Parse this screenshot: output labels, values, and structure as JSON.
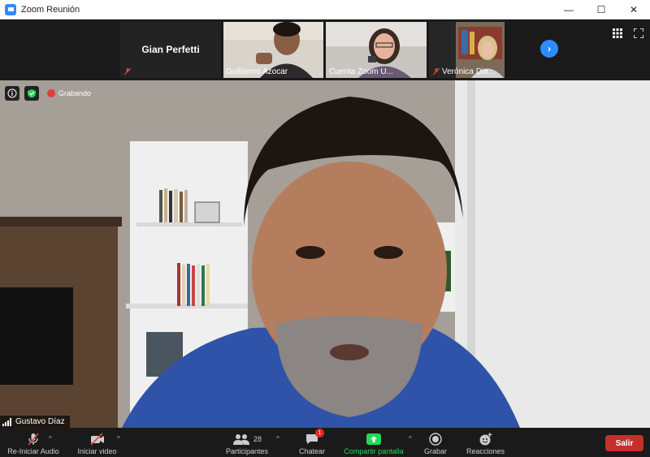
{
  "window": {
    "title": "Zoom Reunión",
    "minimize": "—",
    "maximize": "☐",
    "close": "✕"
  },
  "gallery": {
    "tiles": [
      {
        "name": "Gian Perfetti",
        "muted": true
      },
      {
        "name": "Guillermo Azocar",
        "muted": false
      },
      {
        "name": "Cuenta Zoom U...",
        "muted": false
      },
      {
        "name": "Verónica Dia...",
        "muted": true
      }
    ],
    "next_label": "›"
  },
  "meeting": {
    "recording_label": "Grabando",
    "active_speaker": "Gustavo Díaz"
  },
  "toolbar": {
    "audio_label": "Re-Iniciar Audio",
    "video_label": "Iniciar video",
    "participants_label": "Participantes",
    "participants_count": "28",
    "chat_label": "Chatear",
    "chat_badge": "1",
    "share_label": "Compartir pantalla",
    "record_label": "Grabar",
    "reactions_label": "Reacciones",
    "leave_label": "Salir",
    "caret": "^"
  },
  "colors": {
    "accent": "#2d8cff",
    "share_green": "#23d959",
    "leave_red": "#c4302b",
    "rec_red": "#e23c3c"
  }
}
